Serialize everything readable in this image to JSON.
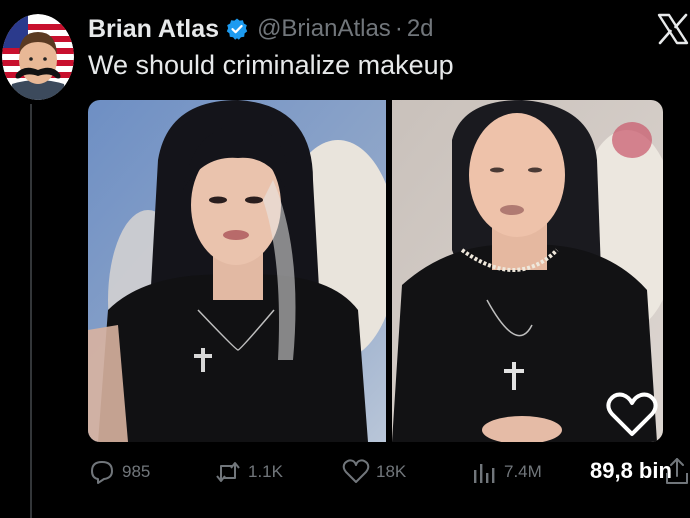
{
  "author": {
    "display_name": "Brian Atlas",
    "handle": "@BrianAtlas",
    "separator": "·",
    "age": "2d",
    "verified": true
  },
  "tweet": {
    "text": "We should criminalize makeup"
  },
  "actions": {
    "replies": "985",
    "reposts": "1.1K",
    "likes": "18K",
    "views": "7.4M"
  },
  "overlay": {
    "counter_text": "89,8 bin"
  },
  "icons": {
    "verified": "verified-badge-icon",
    "x_logo": "x-logo-icon",
    "reply": "reply-icon",
    "repost": "repost-icon",
    "like": "heart-icon",
    "views": "views-icon",
    "share": "share-icon"
  },
  "colors": {
    "background": "#000000",
    "text": "#e7e9ea",
    "muted": "#71767b",
    "verified": "#1d9bf0"
  }
}
